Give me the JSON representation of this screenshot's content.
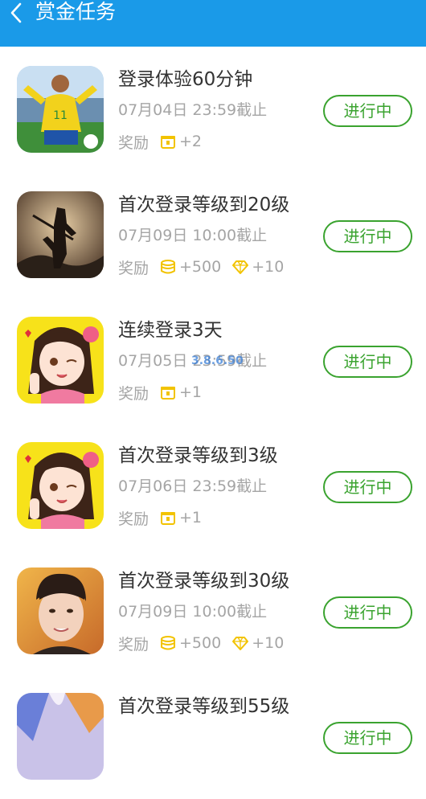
{
  "header": {
    "title": "赏金任务",
    "back_icon": "chevron-left-icon",
    "bg": "#1a9ae8"
  },
  "reward_label": "奖励",
  "status_color": "#3aa32f",
  "overlay_text": "3.8.6.50",
  "tasks": [
    {
      "title": "登录体验60分钟",
      "deadline": "07月04日 23:59截止",
      "status": "进行中",
      "rewards": [
        {
          "icon": "gift-box-icon",
          "value": "+2"
        }
      ]
    },
    {
      "title": "首次登录等级到20级",
      "deadline": "07月09日 10:00截止",
      "status": "进行中",
      "rewards": [
        {
          "icon": "coins-icon",
          "value": "+500"
        },
        {
          "icon": "diamond-icon",
          "value": "+10"
        }
      ]
    },
    {
      "title": "连续登录3天",
      "deadline": "07月05日 23:59截止",
      "status": "进行中",
      "rewards": [
        {
          "icon": "gift-box-icon",
          "value": "+1"
        }
      ]
    },
    {
      "title": "首次登录等级到3级",
      "deadline": "07月06日 23:59截止",
      "status": "进行中",
      "rewards": [
        {
          "icon": "gift-box-icon",
          "value": "+1"
        }
      ]
    },
    {
      "title": "首次登录等级到30级",
      "deadline": "07月09日 10:00截止",
      "status": "进行中",
      "rewards": [
        {
          "icon": "coins-icon",
          "value": "+500"
        },
        {
          "icon": "diamond-icon",
          "value": "+10"
        }
      ]
    },
    {
      "title": "首次登录等级到55级",
      "deadline": "",
      "status": "进行中",
      "rewards": []
    }
  ]
}
